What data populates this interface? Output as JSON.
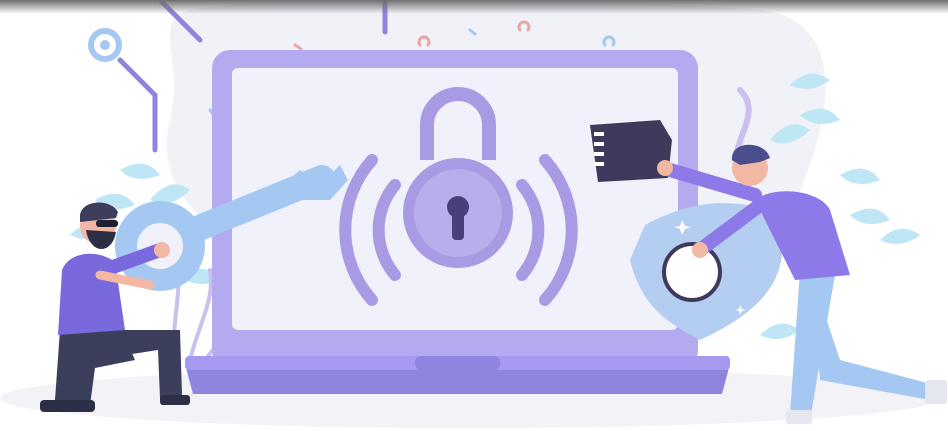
{
  "illustration": {
    "label": "",
    "colors": {
      "laptop_frame": "#b3aaf0",
      "laptop_screen": "#f1f1fb",
      "laptop_base": "#8f84de",
      "lock": "#a99be3",
      "lock_dark": "#8c7dd3",
      "waves": "#a99be3",
      "key": "#a5c8f2",
      "shield": "#b3cef1",
      "blob": "#f1f2f8",
      "leaf": "#bfe6f4",
      "person_shirt": "#7a68dd",
      "person_pants": "#3c3f5c",
      "person_skin": "#f2b8a4",
      "card": "#3f3a5c"
    },
    "icons": [
      "padlock-icon",
      "key-icon",
      "shield-icon",
      "memory-card-icon"
    ]
  }
}
